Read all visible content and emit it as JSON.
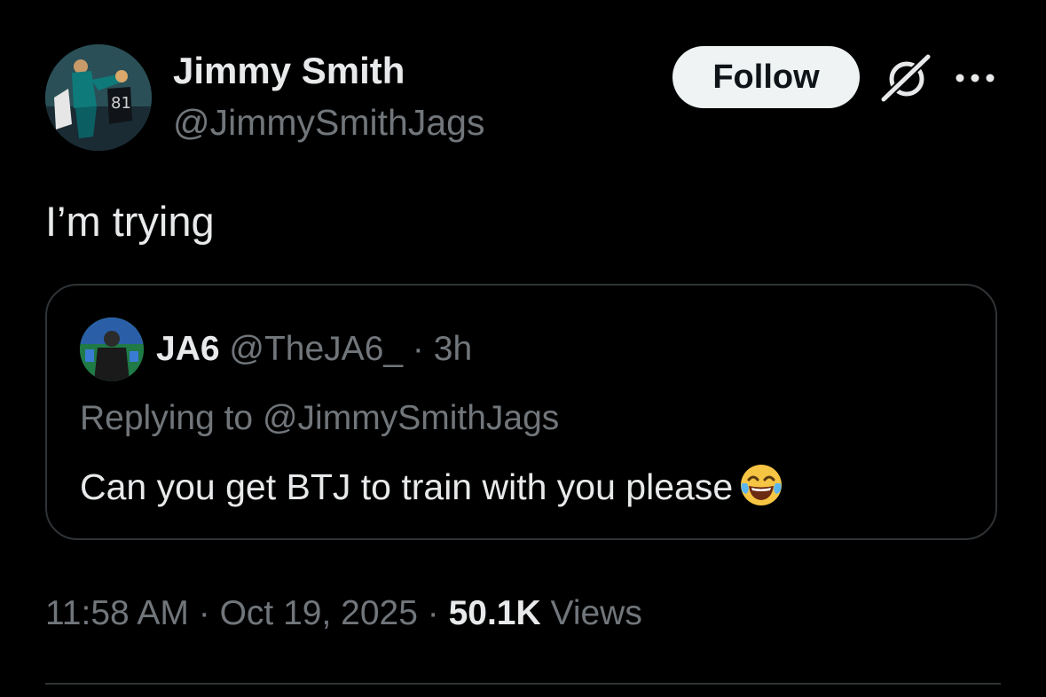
{
  "tweet": {
    "author": {
      "display_name": "Jimmy Smith",
      "handle": "@JimmySmithJags",
      "avatar_icon": "avatar-photo"
    },
    "follow_label": "Follow",
    "grok_icon": "grok-icon",
    "more_icon": "more-icon",
    "text": "I’m trying",
    "timestamp": "11:58 AM",
    "separator": "·",
    "date": "Oct 19, 2025",
    "views_count": "50.1K",
    "views_label": "Views"
  },
  "quote": {
    "display_name": "JA6",
    "handle": "@TheJA6_",
    "separator": "·",
    "age": "3h",
    "replying_prefix": "Replying to",
    "replying_handle": "@JimmySmithJags",
    "text": "Can you get BTJ to train with you please",
    "emoji": "face-with-tears-of-joy-icon"
  },
  "colors": {
    "background": "#000000",
    "primary_text": "#e7e9ea",
    "secondary_text": "#71767b",
    "border": "#2f3336",
    "follow_bg": "#eff3f4"
  }
}
